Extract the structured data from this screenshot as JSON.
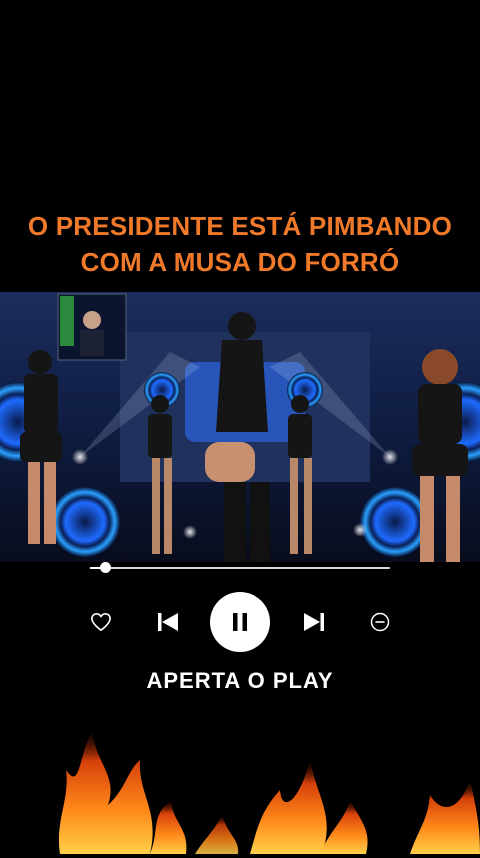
{
  "headline": {
    "line1": "O PRESIDENTE ESTÁ PIMBANDO",
    "line2": "COM A MUSA DO FORRÓ"
  },
  "player": {
    "progress": 0.05,
    "controls": [
      "heart-icon",
      "skip-back-icon",
      "pause-icon",
      "skip-forward-icon",
      "minus-circle-icon"
    ]
  },
  "cta": {
    "label": "APERTA O PLAY"
  },
  "colors": {
    "headline": "#F07A2A",
    "background": "#000000",
    "controls": "#FFFFFF"
  }
}
